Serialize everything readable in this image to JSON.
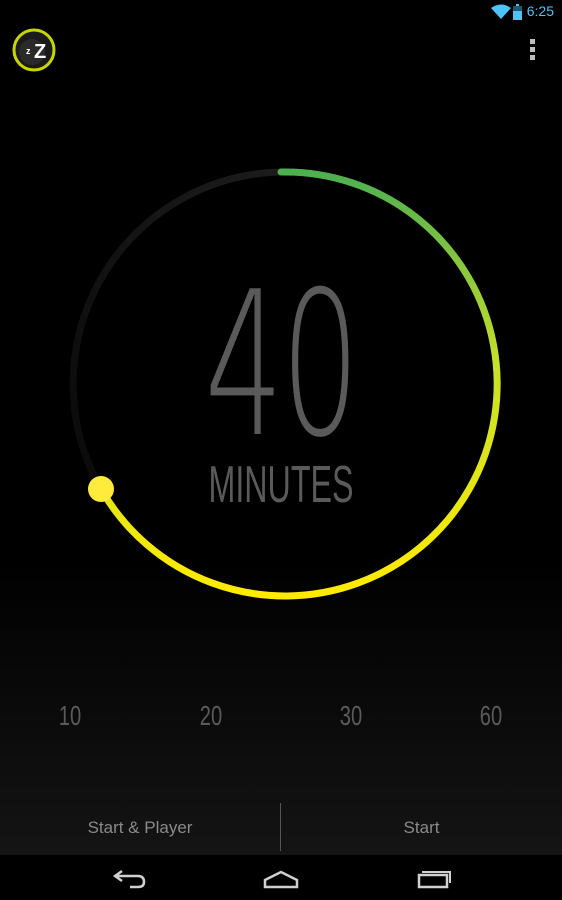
{
  "status_bar": {
    "time": "6:25",
    "icons": [
      "wifi-icon",
      "battery-icon"
    ],
    "accent_color": "#4fc3f7"
  },
  "header": {
    "logo_icon": "sleep-timer-logo-icon",
    "menu_icon": "overflow-menu-icon"
  },
  "timer": {
    "value": "40",
    "unit": "MINUTES",
    "dial_fraction": 0.667,
    "colors": {
      "arc_start": "#4caf50",
      "arc_mid": "#c6e02a",
      "arc_end": "#ffeb00",
      "track": "#161616"
    }
  },
  "presets": [
    "10",
    "20",
    "30",
    "60"
  ],
  "actions": {
    "start_and_player": "Start & Player",
    "start": "Start"
  },
  "nav": {
    "icons": [
      "back-icon",
      "home-icon",
      "recent-apps-icon"
    ]
  }
}
